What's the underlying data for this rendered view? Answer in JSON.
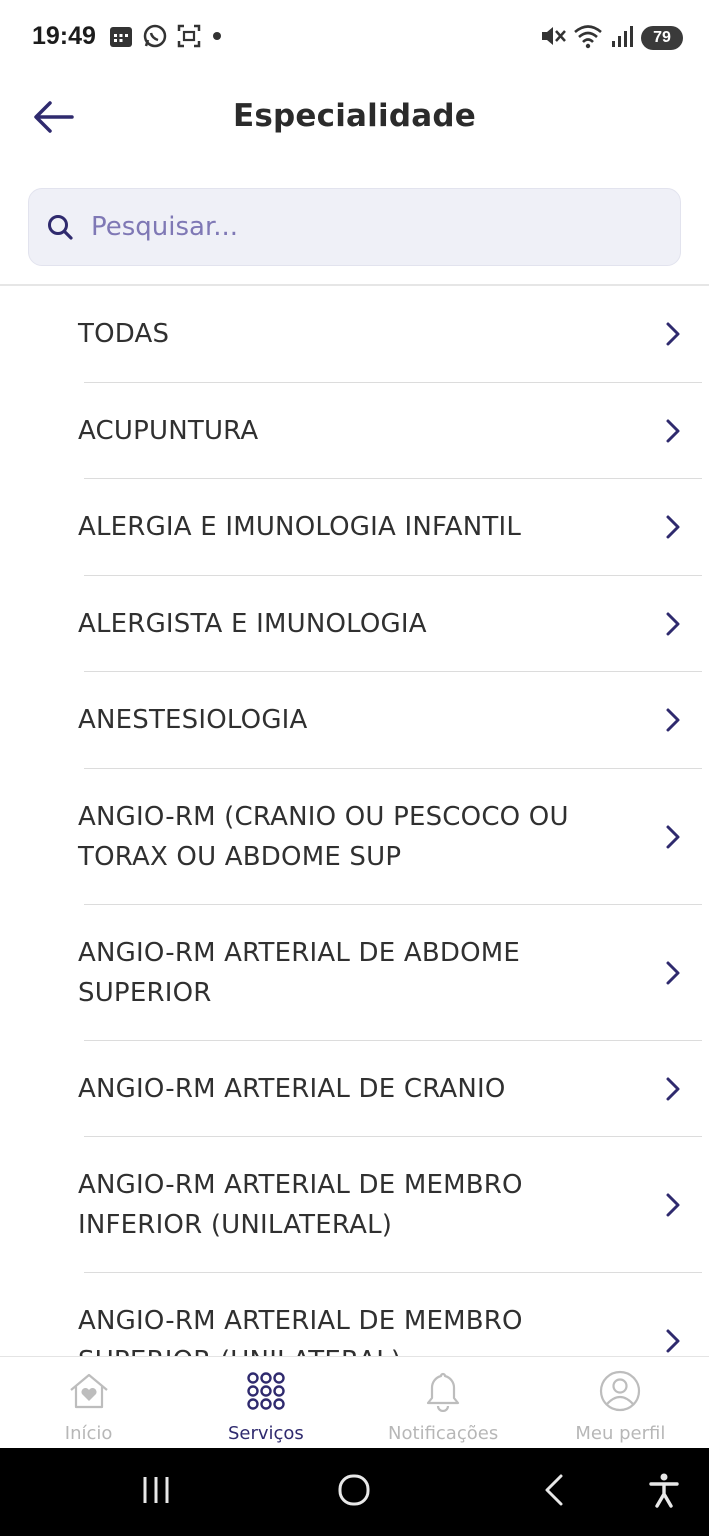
{
  "status_bar": {
    "time": "19:49",
    "battery": "79",
    "left_icons": [
      "calendar-icon",
      "whatsapp-icon",
      "screenshot-icon",
      "dot-icon"
    ],
    "right_icons": [
      "mute-icon",
      "wifi-icon",
      "signal-icon"
    ]
  },
  "header": {
    "title": "Especialidade",
    "back_icon": "arrow-left-icon"
  },
  "search": {
    "placeholder": "Pesquisar...",
    "value": ""
  },
  "specialties": [
    "TODAS",
    "ACUPUNTURA",
    "ALERGIA E IMUNOLOGIA INFANTIL",
    "ALERGISTA E IMUNOLOGIA",
    "ANESTESIOLOGIA",
    "ANGIO-RM (CRANIO OU PESCOCO OU TORAX OU ABDOME SUP",
    "ANGIO-RM ARTERIAL DE ABDOME SUPERIOR",
    "ANGIO-RM ARTERIAL DE CRANIO",
    "ANGIO-RM ARTERIAL DE MEMBRO INFERIOR (UNILATERAL)",
    "ANGIO-RM ARTERIAL DE MEMBRO SUPERIOR (UNILATERAL)"
  ],
  "bottom_nav": {
    "items": [
      {
        "label": "Início",
        "icon": "home-heart-icon",
        "active": false
      },
      {
        "label": "Serviços",
        "icon": "grid-icon",
        "active": true
      },
      {
        "label": "Notificações",
        "icon": "bell-icon",
        "active": false
      },
      {
        "label": "Meu perfil",
        "icon": "user-icon",
        "active": false
      }
    ]
  },
  "colors": {
    "accent": "#2f2a6e",
    "search_bg": "#eff0f7",
    "placeholder": "#7f78b5",
    "inactive_nav": "#b7b7b7"
  }
}
